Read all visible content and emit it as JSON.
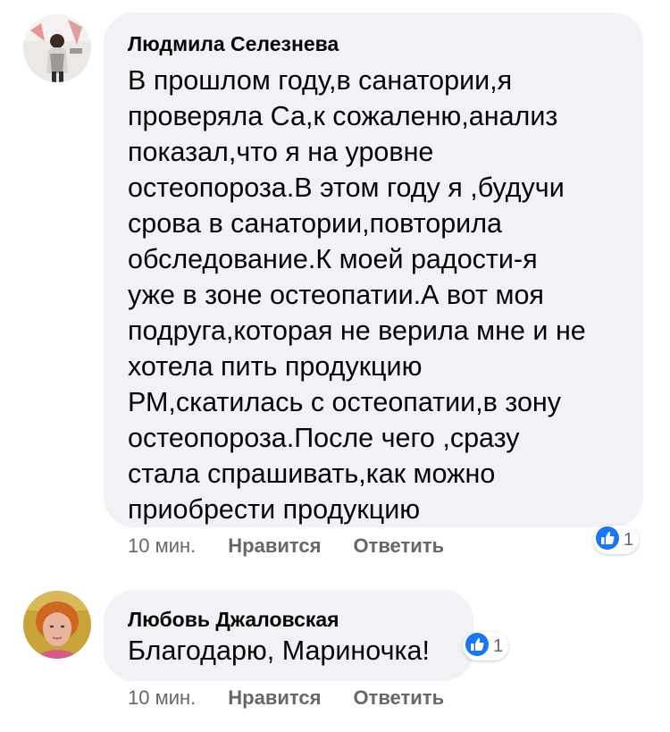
{
  "comments": [
    {
      "author": "Людмила Селезнева",
      "text_lines": [
        "В прошлом году,в санатории,я",
        "проверяла Са,к сожаленю,анализ",
        "показал,что я на уровне",
        "остеопороза.В этом году я ,будучи",
        "срова в санатории,повторила",
        "обследование.К моей радости-я",
        "уже в зоне остеопатии.А вот моя",
        "подруга,которая не верила мне и не",
        "хотела пить продукцию",
        "РМ,скатилась с остеопатии,в зону",
        "остеопороза.После чего ,сразу",
        "стала спрашивать,как можно",
        "приобрести продукцию"
      ],
      "time": "10 мин.",
      "like_label": "Нравится",
      "reply_label": "Ответить",
      "reaction_icon": "thumbs-up-icon",
      "reaction_count": "1"
    },
    {
      "author": "Любовь Джаловская",
      "text_lines": [
        "Благодарю, Мариночка!"
      ],
      "time": "10 мин.",
      "like_label": "Нравится",
      "reply_label": "Ответить",
      "reaction_icon": "thumbs-up-icon",
      "reaction_count": "1"
    }
  ],
  "colors": {
    "bubble": "#f0f2f5",
    "meta_text": "#65676b",
    "like_blue": "#1877f2"
  }
}
